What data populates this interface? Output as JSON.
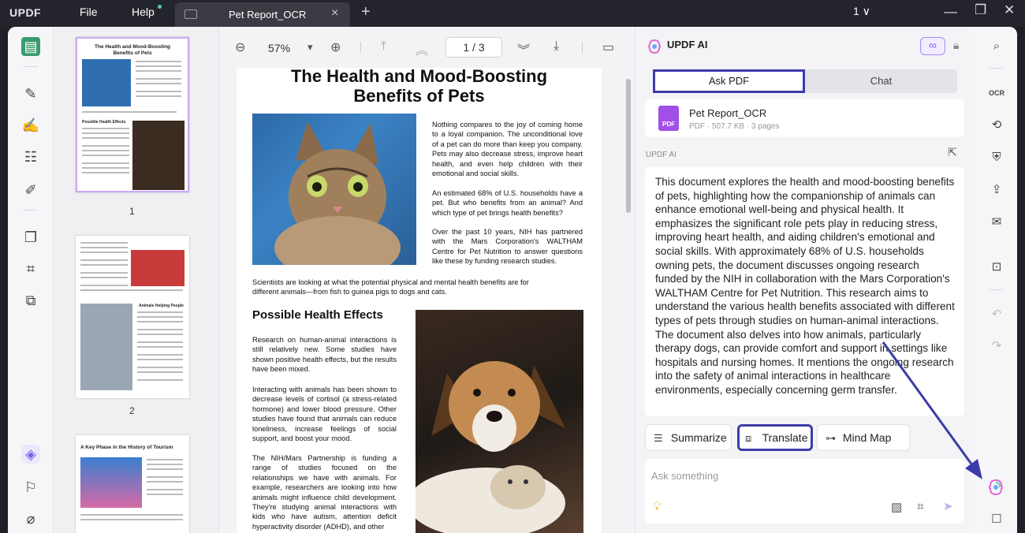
{
  "titlebar": {
    "logo": "UPDF",
    "menu_file": "File",
    "menu_help": "Help",
    "tab_title": "Pet Report_OCR",
    "tab_close": "×",
    "new_tab": "+",
    "window_selector": "1 ∨",
    "minimize": "—",
    "restore": "❐",
    "close": "✕"
  },
  "toolbar": {
    "zoom_out": "⊖",
    "zoom_value": "57%",
    "zoom_dropdown": "▾",
    "zoom_in": "⊕",
    "page_indicator": "1 / 3"
  },
  "thumbnails": [
    {
      "page": "1"
    },
    {
      "page": "2"
    }
  ],
  "thumbnail_texts": {
    "t1_title": "The Health and Mood-Boosting Benefits of Pets",
    "t1_heading": "Possible Health Effects",
    "t2_heading": "Animals Helping People",
    "t3_title": "A Key Phase in the History of Tourism"
  },
  "page": {
    "title": "The Health and Mood-Boosting Benefits of Pets",
    "intro_p1": "Nothing compares to the joy of coming home to a loyal companion. The unconditional love of a pet can do more than keep you company. Pets may also decrease stress, improve heart health, and even help children with their emotional and social skills.",
    "intro_p2": "An estimated 68% of U.S. households have a pet. But who benefits from an animal? And which type of pet brings health benefits?",
    "intro_p3": "Over the past 10 years, NIH has partnered with the Mars Corporation's WALTHAM Centre for Pet Nutrition to answer questions like these by funding research studies.",
    "caption": "Scientists are looking at what the potential physical and mental health benefits are for different animals—from fish to guinea pigs to dogs and cats.",
    "section_heading": "Possible Health Effects",
    "body_p1": "Research on human-animal interactions is still relatively new. Some studies have shown positive health effects, but the results have been mixed.",
    "body_p2": "Interacting with animals has been shown to decrease levels of cortisol (a stress-related hormone) and lower blood pressure. Other studies have found that animals can reduce loneliness, increase feelings of social support, and boost your mood.",
    "body_p3": "The NIH/Mars Partnership is funding a range of studies focused on the relationships we have with animals. For example, researchers are looking into how animals might influence child development. They're studying animal interactions with kids who have autism, attention deficit hyperactivity disorder (ADHD), and other"
  },
  "ai_panel": {
    "title": "UPDF AI",
    "infinity_icon": "∞",
    "tab_ask": "Ask PDF",
    "tab_chat": "Chat",
    "file_icon_label": "PDF",
    "file_name": "Pet Report_OCR",
    "file_meta": "PDF · 507.7 KB · 3 pages",
    "source_label": "UPDF AI",
    "answer_p1": "This document explores the health and mood-boosting benefits of pets, highlighting how the companionship of animals can enhance emotional well-being and physical health. It emphasizes the significant role pets play in reducing stress, improving heart health, and aiding children's emotional and social skills. With approximately 68% of U.S. households owning pets, the document discusses ongoing research funded by the NIH in collaboration with the Mars Corporation's WALTHAM Centre for Pet Nutrition. This research aims to understand the various health benefits associated with different types of pets through studies on human-animal interactions.",
    "answer_p2": "The document also delves into how animals, particularly therapy dogs, can provide comfort and support in settings like hospitals and nursing homes. It mentions the ongoing research into the safety of animal interactions in healthcare environments, especially concerning germ transfer.",
    "summarize": "Summarize",
    "translate": "Translate",
    "mind_map": "Mind Map",
    "ask_placeholder": "Ask something"
  },
  "colors": {
    "highlight_box": "#3c3ca8",
    "accent_purple": "#8b5cf6",
    "pdf_icon": "#a14fe6"
  }
}
